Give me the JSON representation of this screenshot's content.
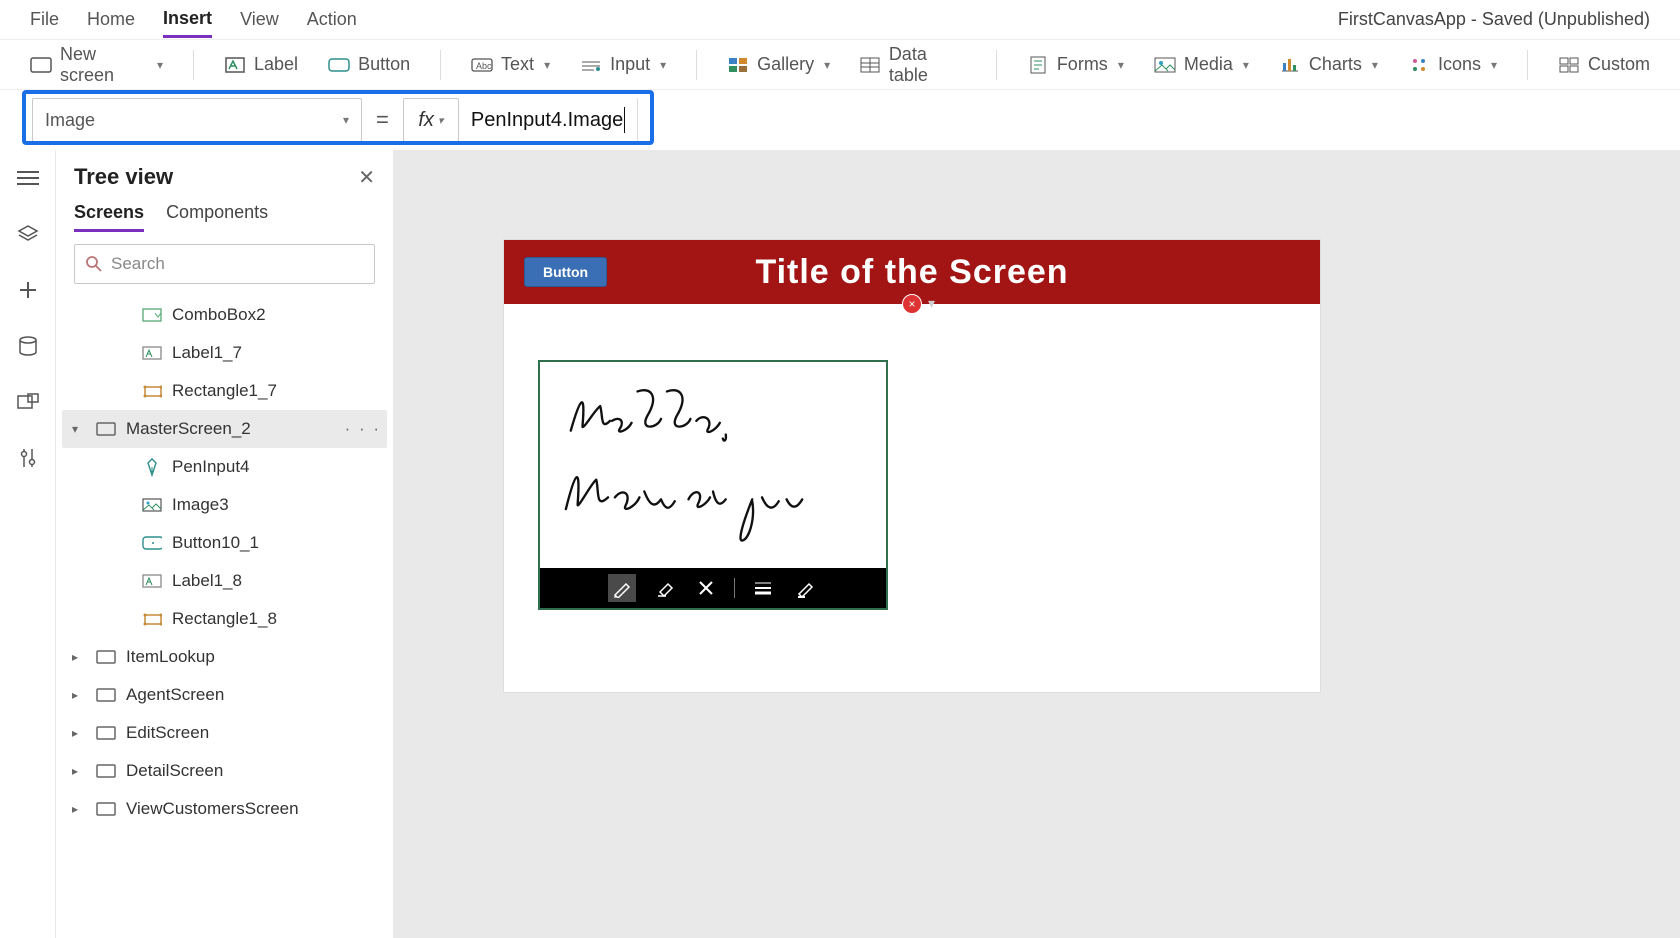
{
  "menu": {
    "items": [
      "File",
      "Home",
      "Insert",
      "View",
      "Action"
    ],
    "active_index": 2,
    "status": "FirstCanvasApp - Saved (Unpublished)"
  },
  "ribbon": {
    "new_screen": "New screen",
    "label": "Label",
    "button": "Button",
    "text": "Text",
    "input": "Input",
    "gallery": "Gallery",
    "data_table": "Data table",
    "forms": "Forms",
    "media": "Media",
    "charts": "Charts",
    "icons": "Icons",
    "custom": "Custom"
  },
  "formula": {
    "property": "Image",
    "fx": "fx",
    "value": "PenInput4.Image"
  },
  "tree": {
    "title": "Tree view",
    "tabs": [
      "Screens",
      "Components"
    ],
    "active_tab": 0,
    "search_placeholder": "Search",
    "items": [
      {
        "label": "ComboBox2",
        "level": 1,
        "icon": "combobox"
      },
      {
        "label": "Label1_7",
        "level": 1,
        "icon": "label"
      },
      {
        "label": "Rectangle1_7",
        "level": 1,
        "icon": "rect"
      },
      {
        "label": "MasterScreen_2",
        "level": 0,
        "icon": "screen",
        "expanded": true,
        "selected": true,
        "more": true
      },
      {
        "label": "PenInput4",
        "level": 1,
        "icon": "pen"
      },
      {
        "label": "Image3",
        "level": 1,
        "icon": "image"
      },
      {
        "label": "Button10_1",
        "level": 1,
        "icon": "button"
      },
      {
        "label": "Label1_8",
        "level": 1,
        "icon": "label"
      },
      {
        "label": "Rectangle1_8",
        "level": 1,
        "icon": "rect"
      },
      {
        "label": "ItemLookup",
        "level": 0,
        "icon": "screen",
        "expanded": false
      },
      {
        "label": "AgentScreen",
        "level": 0,
        "icon": "screen",
        "expanded": false
      },
      {
        "label": "EditScreen",
        "level": 0,
        "icon": "screen",
        "expanded": false
      },
      {
        "label": "DetailScreen",
        "level": 0,
        "icon": "screen",
        "expanded": false
      },
      {
        "label": "ViewCustomersScreen",
        "level": 0,
        "icon": "screen",
        "expanded": false
      }
    ]
  },
  "canvas": {
    "header_button": "Button",
    "header_title": "Title of the Screen",
    "error_badge": "×",
    "pen_tools": [
      "pen",
      "eraser",
      "clear",
      "lines",
      "stroke"
    ]
  }
}
